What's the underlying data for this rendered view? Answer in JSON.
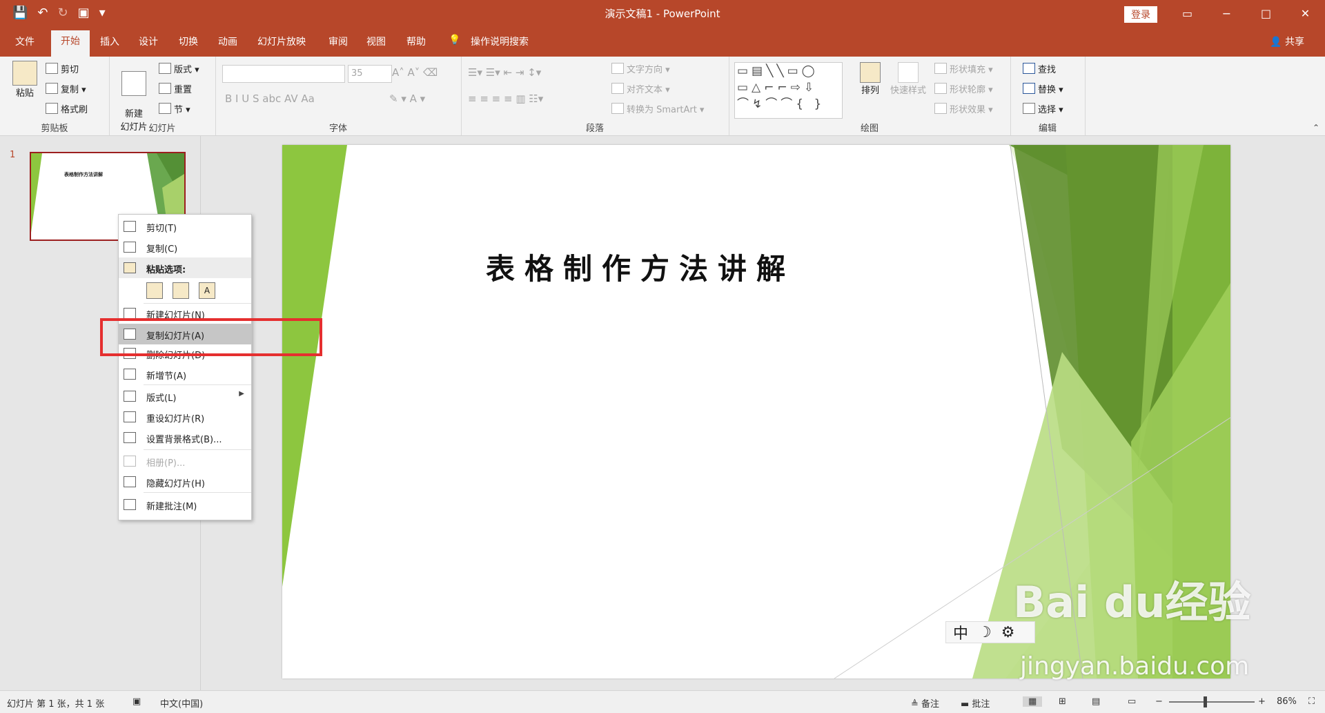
{
  "window": {
    "title": "演示文稿1 - PowerPoint",
    "login_label": "登录",
    "controls": [
      "−",
      "□",
      "✕"
    ]
  },
  "tabs": [
    "文件",
    "开始",
    "插入",
    "设计",
    "切换",
    "动画",
    "幻灯片放映",
    "审阅",
    "视图",
    "帮助",
    "操作说明搜索"
  ],
  "share_label": "共享",
  "ribbon": {
    "clipboard": {
      "label": "剪贴板",
      "paste": "粘贴",
      "cut": "剪切",
      "copy": "复制",
      "format_painter": "格式刷"
    },
    "slides": {
      "label": "幻灯片",
      "new_slide": "新建\n幻灯片",
      "layout": "版式",
      "reset": "重置",
      "section": "节"
    },
    "font": {
      "label": "字体",
      "size": "35",
      "buttons": "B  I  U  S  abc  AV  Aa"
    },
    "paragraph": {
      "label": "段落",
      "text_direction": "文字方向",
      "align_text": "对齐文本",
      "convert_smartart": "转换为 SmartArt"
    },
    "drawing": {
      "label": "绘图",
      "arrange": "排列",
      "quick_styles": "快速样式",
      "shape_fill": "形状填充",
      "shape_outline": "形状轮廓",
      "shape_effects": "形状效果"
    },
    "editing": {
      "label": "编辑",
      "find": "查找",
      "replace": "替换",
      "select": "选择"
    }
  },
  "thumbnail": {
    "number": "1",
    "title": "表格制作方法讲解"
  },
  "slide": {
    "title": "表格制作方法讲解"
  },
  "context_menu": [
    {
      "label": "剪切(T)",
      "state": "normal"
    },
    {
      "label": "复制(C)",
      "state": "normal"
    },
    {
      "label": "粘贴选项:",
      "state": "header"
    },
    {
      "label": "新建幻灯片(N)",
      "state": "normal"
    },
    {
      "label": "复制幻灯片(A)",
      "state": "highlight"
    },
    {
      "label": "删除幻灯片(D)",
      "state": "normal"
    },
    {
      "label": "新增节(A)",
      "state": "normal"
    },
    {
      "label": "版式(L)",
      "state": "normal"
    },
    {
      "label": "重设幻灯片(R)",
      "state": "normal"
    },
    {
      "label": "设置背景格式(B)...",
      "state": "normal"
    },
    {
      "label": "相册(P)...",
      "state": "disabled"
    },
    {
      "label": "隐藏幻灯片(H)",
      "state": "normal"
    },
    {
      "label": "新建批注(M)",
      "state": "normal"
    }
  ],
  "ime": {
    "mode": "中",
    "moon": "☽"
  },
  "watermark": {
    "brand": "Bai du经验",
    "url": "jingyan.baidu.com"
  },
  "status": {
    "slide_info": "幻灯片 第 1 张，共 1 张",
    "language": "中文(中国)",
    "notes": "备注",
    "comments": "批注",
    "zoom": "86%"
  },
  "colors": {
    "accent": "#b7472a",
    "slide_green": "#8dc63f",
    "highlight_box": "#e52f2f"
  }
}
